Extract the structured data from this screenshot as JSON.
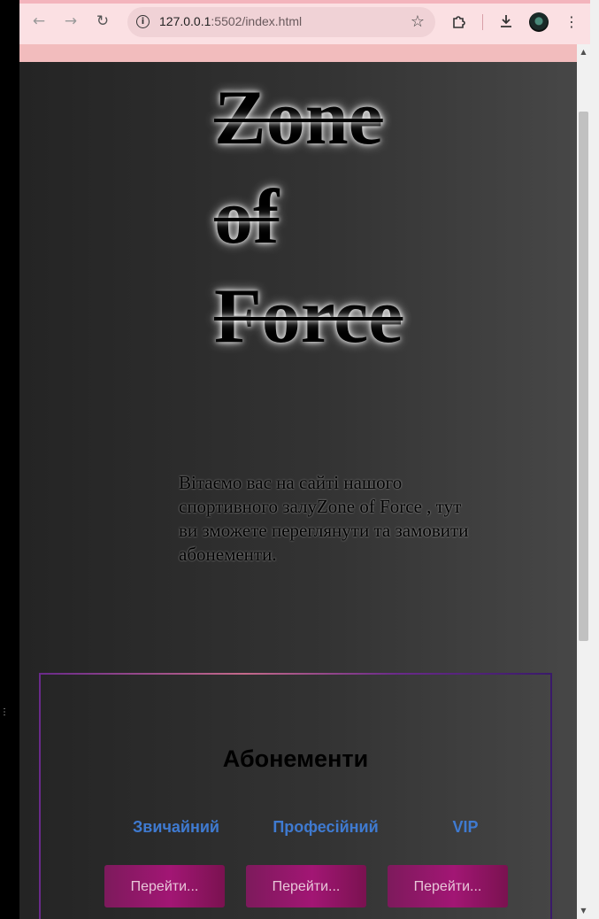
{
  "browser": {
    "url_host": "127.0.0.1",
    "url_path": ":5502/index.html",
    "icons": {
      "back": "arrow-left-icon",
      "forward": "arrow-right-icon",
      "reload": "reload-icon",
      "site_info": "info-icon",
      "bookmark": "star-icon",
      "extensions": "puzzle-icon",
      "downloads": "download-icon",
      "profile": "avatar",
      "menu": "kebab-menu-icon"
    },
    "chrome_color": "#fbe0e3"
  },
  "page": {
    "logo_lines": [
      "Zone",
      "of",
      "Force"
    ],
    "welcome_text": "Вітаємо вас на сайті нашого спортивного залуZone of Force , тут ви зможете переглянути та замовити абонементи.",
    "subscriptions": {
      "title": "Абонементи",
      "plans": [
        {
          "name": "Звичайний",
          "button": "Перейти..."
        },
        {
          "name": "Професійний",
          "button": "Перейти..."
        },
        {
          "name": "VIP",
          "button": "Перейти..."
        }
      ]
    },
    "colors": {
      "plan_name": "#3f7ad0",
      "button": "#a21674",
      "banner": "#f2bcbd"
    }
  }
}
